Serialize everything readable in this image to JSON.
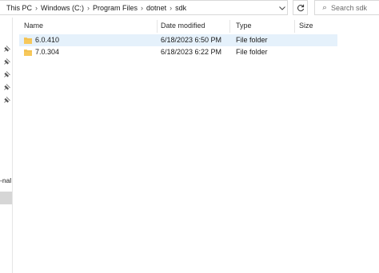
{
  "address": {
    "crumbs": [
      "This PC",
      "Windows (C:)",
      "Program Files",
      "dotnet",
      "sdk"
    ],
    "dropdown_icon": "chevron-down-icon",
    "refresh_icon": "refresh-icon"
  },
  "search": {
    "placeholder": "Search sdk",
    "icon": "search-icon"
  },
  "navpane": {
    "fragment_label": "-nal",
    "pins": 5
  },
  "columns": {
    "name": "Name",
    "date": "Date modified",
    "type": "Type",
    "size": "Size"
  },
  "rows": [
    {
      "name": "6.0.410",
      "date": "6/18/2023 6:50 PM",
      "type": "File folder",
      "size": "",
      "selected": true
    },
    {
      "name": "7.0.304",
      "date": "6/18/2023 6:22 PM",
      "type": "File folder",
      "size": "",
      "selected": false
    }
  ],
  "colors": {
    "selection": "#e5f1fb",
    "folder": "#f7c85a"
  }
}
